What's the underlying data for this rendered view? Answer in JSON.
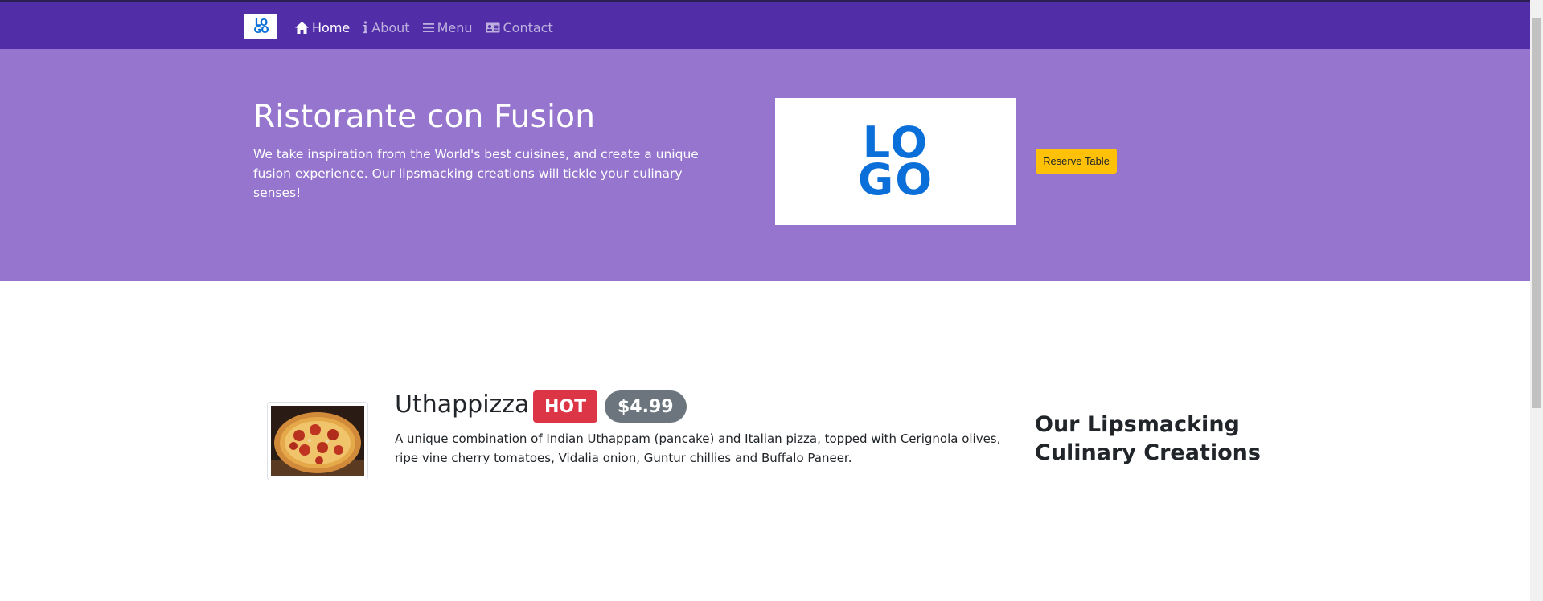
{
  "navbar": {
    "brand_letters": [
      "LO",
      "GO"
    ],
    "items": [
      {
        "label": "Home",
        "icon": "home-icon",
        "active": true
      },
      {
        "label": "About",
        "icon": "info-icon",
        "active": false
      },
      {
        "label": "Menu",
        "icon": "list-icon",
        "active": false
      },
      {
        "label": "Contact",
        "icon": "address-card-icon",
        "active": false
      }
    ]
  },
  "hero": {
    "title": "Ristorante con Fusion",
    "text": "We take inspiration from the World's best cuisines, and create a unique fusion experience. Our lipsmacking creations will tickle your culinary senses!",
    "logo_letters": [
      "LO",
      "GO"
    ],
    "reserve_label": "Reserve Table"
  },
  "featured": {
    "name": "Uthappizza",
    "badge": "HOT",
    "price": "$4.99",
    "description": "A unique combination of Indian Uthappam (pancake) and Italian pizza, topped with Cerignola olives, ripe vine cherry tomatoes, Vidalia onion, Guntur chillies and Buffalo Paneer."
  },
  "side_heading": "Our Lipsmacking Culinary Creations",
  "colors": {
    "navbar": "#512da8",
    "jumbotron": "#9575cd",
    "logo_blue": "#0a6fd8",
    "reserve_button": "#ffc107",
    "badge_hot": "#dc3545",
    "badge_price": "#6c757d"
  }
}
